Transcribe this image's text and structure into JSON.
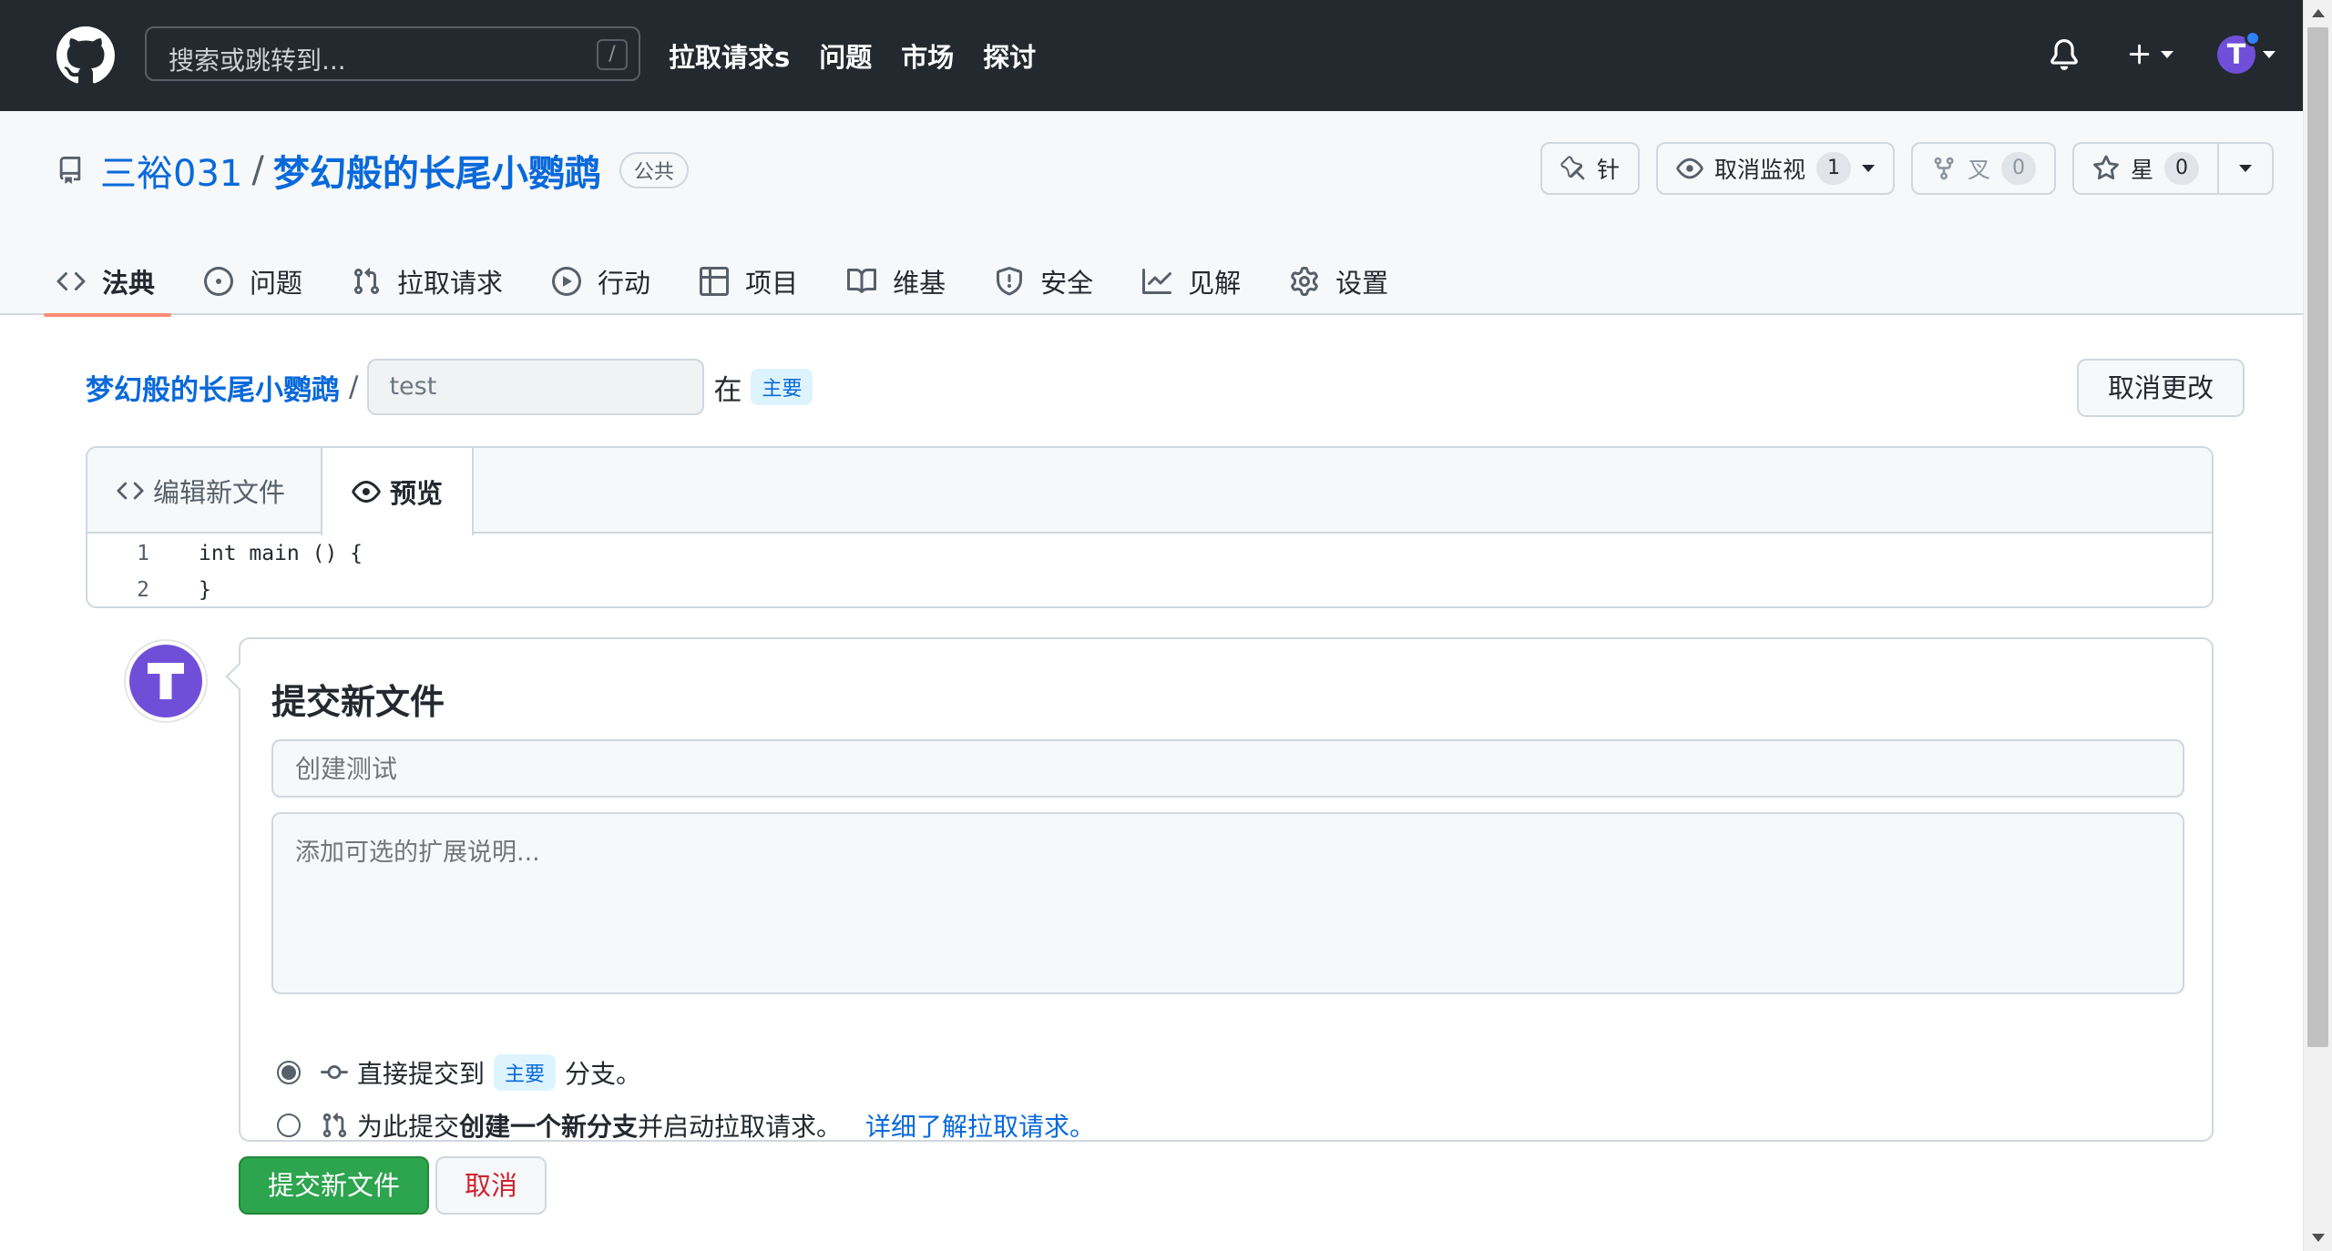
{
  "header": {
    "search_placeholder": "搜索或跳转到...",
    "search_shortcut": "/",
    "nav": [
      "拉取请求s",
      "问题",
      "市场",
      "探讨"
    ],
    "avatar_letter": "T"
  },
  "repo": {
    "owner": "三裕031",
    "separator": "/",
    "name": "梦幻般的长尾小鹦鹉",
    "visibility": "公共",
    "actions": {
      "pin": "针",
      "watch": "取消监视",
      "watch_count": "1",
      "fork": "叉",
      "fork_count": "0",
      "star": "星",
      "star_count": "0"
    },
    "tabs": [
      "法典",
      "问题",
      "拉取请求",
      "行动",
      "项目",
      "维基",
      "安全",
      "见解",
      "设置"
    ]
  },
  "editor": {
    "crumb_repo": "梦幻般的长尾小鹦鹉",
    "crumb_sep": "/",
    "filename": "test",
    "in_label": "在",
    "branch": "主要",
    "cancel_changes": "取消更改",
    "tab_edit": "编辑新文件",
    "tab_preview": "预览",
    "lines": [
      {
        "n": "1",
        "text": "int main () {"
      },
      {
        "n": "2",
        "text": "}"
      }
    ]
  },
  "commit": {
    "title": "提交新文件",
    "summary_placeholder": "创建测试",
    "desc_placeholder": "添加可选的扩展说明...",
    "option_direct_prefix": "直接提交到",
    "option_direct_branch": "主要",
    "option_direct_suffix": "分支。",
    "option_new_prefix": "为此提交",
    "option_new_bold": "创建一个新分支",
    "option_new_suffix": "并启动拉取请求。",
    "option_new_link": "详细了解拉取请求。",
    "submit": "提交新文件",
    "cancel": "取消"
  }
}
